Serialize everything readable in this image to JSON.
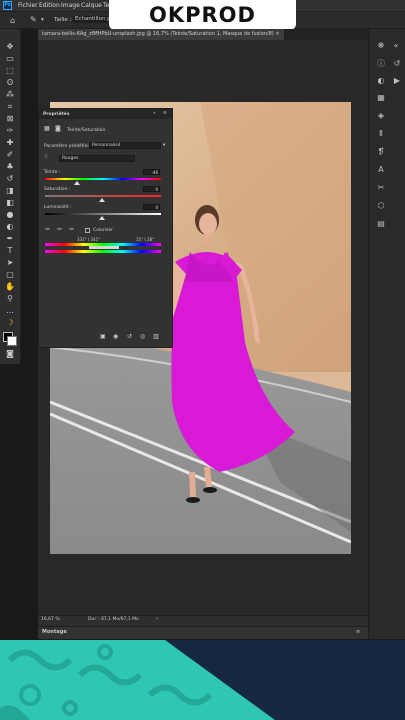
{
  "brand": {
    "logo_text": "OKPROD"
  },
  "menubar": {
    "app_icon": "Ps",
    "items": [
      "Fichier",
      "Edition",
      "Image",
      "Calque",
      "Te"
    ]
  },
  "options_bar": {
    "sample_label": "Taille :",
    "sample_value": "Echantillon ponct"
  },
  "document": {
    "tab_title": "tamara-bellis-6Ag_zfMHPbU-unsplash.jpg @ 16,7% (Teinte/Saturation 1, Masque de fusion/8) ×"
  },
  "properties": {
    "panel_title": "Propriétés",
    "adjustment_name": "Teinte/Saturation",
    "preset_label": "Paramètre prédéfini :",
    "preset_value": "Personnalisé",
    "channel_value": "Rouges",
    "hue_label": "Teinte :",
    "hue_value": "-46",
    "saturation_label": "Saturation :",
    "saturation_value": "0",
    "lightness_label": "Luminosité :",
    "lightness_value": "0",
    "colorize_label": "Coloriser",
    "range_left": "331° / 341°",
    "range_right": "15° \\ 28°"
  },
  "status": {
    "zoom": "16,67 %",
    "doc_size": "Doc : 67,1 Mo/67,1 Mo"
  },
  "timeline": {
    "label": "Montage"
  },
  "colors": {
    "accent": "#31a8ff",
    "dress": "#d81ad6",
    "logo_bg": "#ffffff",
    "brand_teal": "#2fc7b4",
    "brand_navy": "#152840"
  }
}
